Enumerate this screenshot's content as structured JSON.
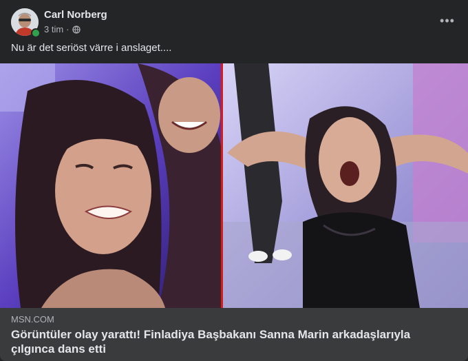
{
  "post": {
    "author": "Carl Norberg",
    "time": "3 tim",
    "separator": "·",
    "privacy_icon": "globe-icon",
    "more_icon": "more-options-icon",
    "more_label": "•••",
    "text": "Nu är det seriöst värre i anslaget...."
  },
  "link_preview": {
    "domain": "MSN.COM",
    "headline": "Görüntüler olay yarattı! Finladiya Başbakanı Sanna Marin arkadaşlarıyla çılgınca dans etti"
  },
  "colors": {
    "background": "#242526",
    "link_box": "#3a3b3c",
    "online": "#31a24c",
    "divider": "#d81c1c"
  }
}
